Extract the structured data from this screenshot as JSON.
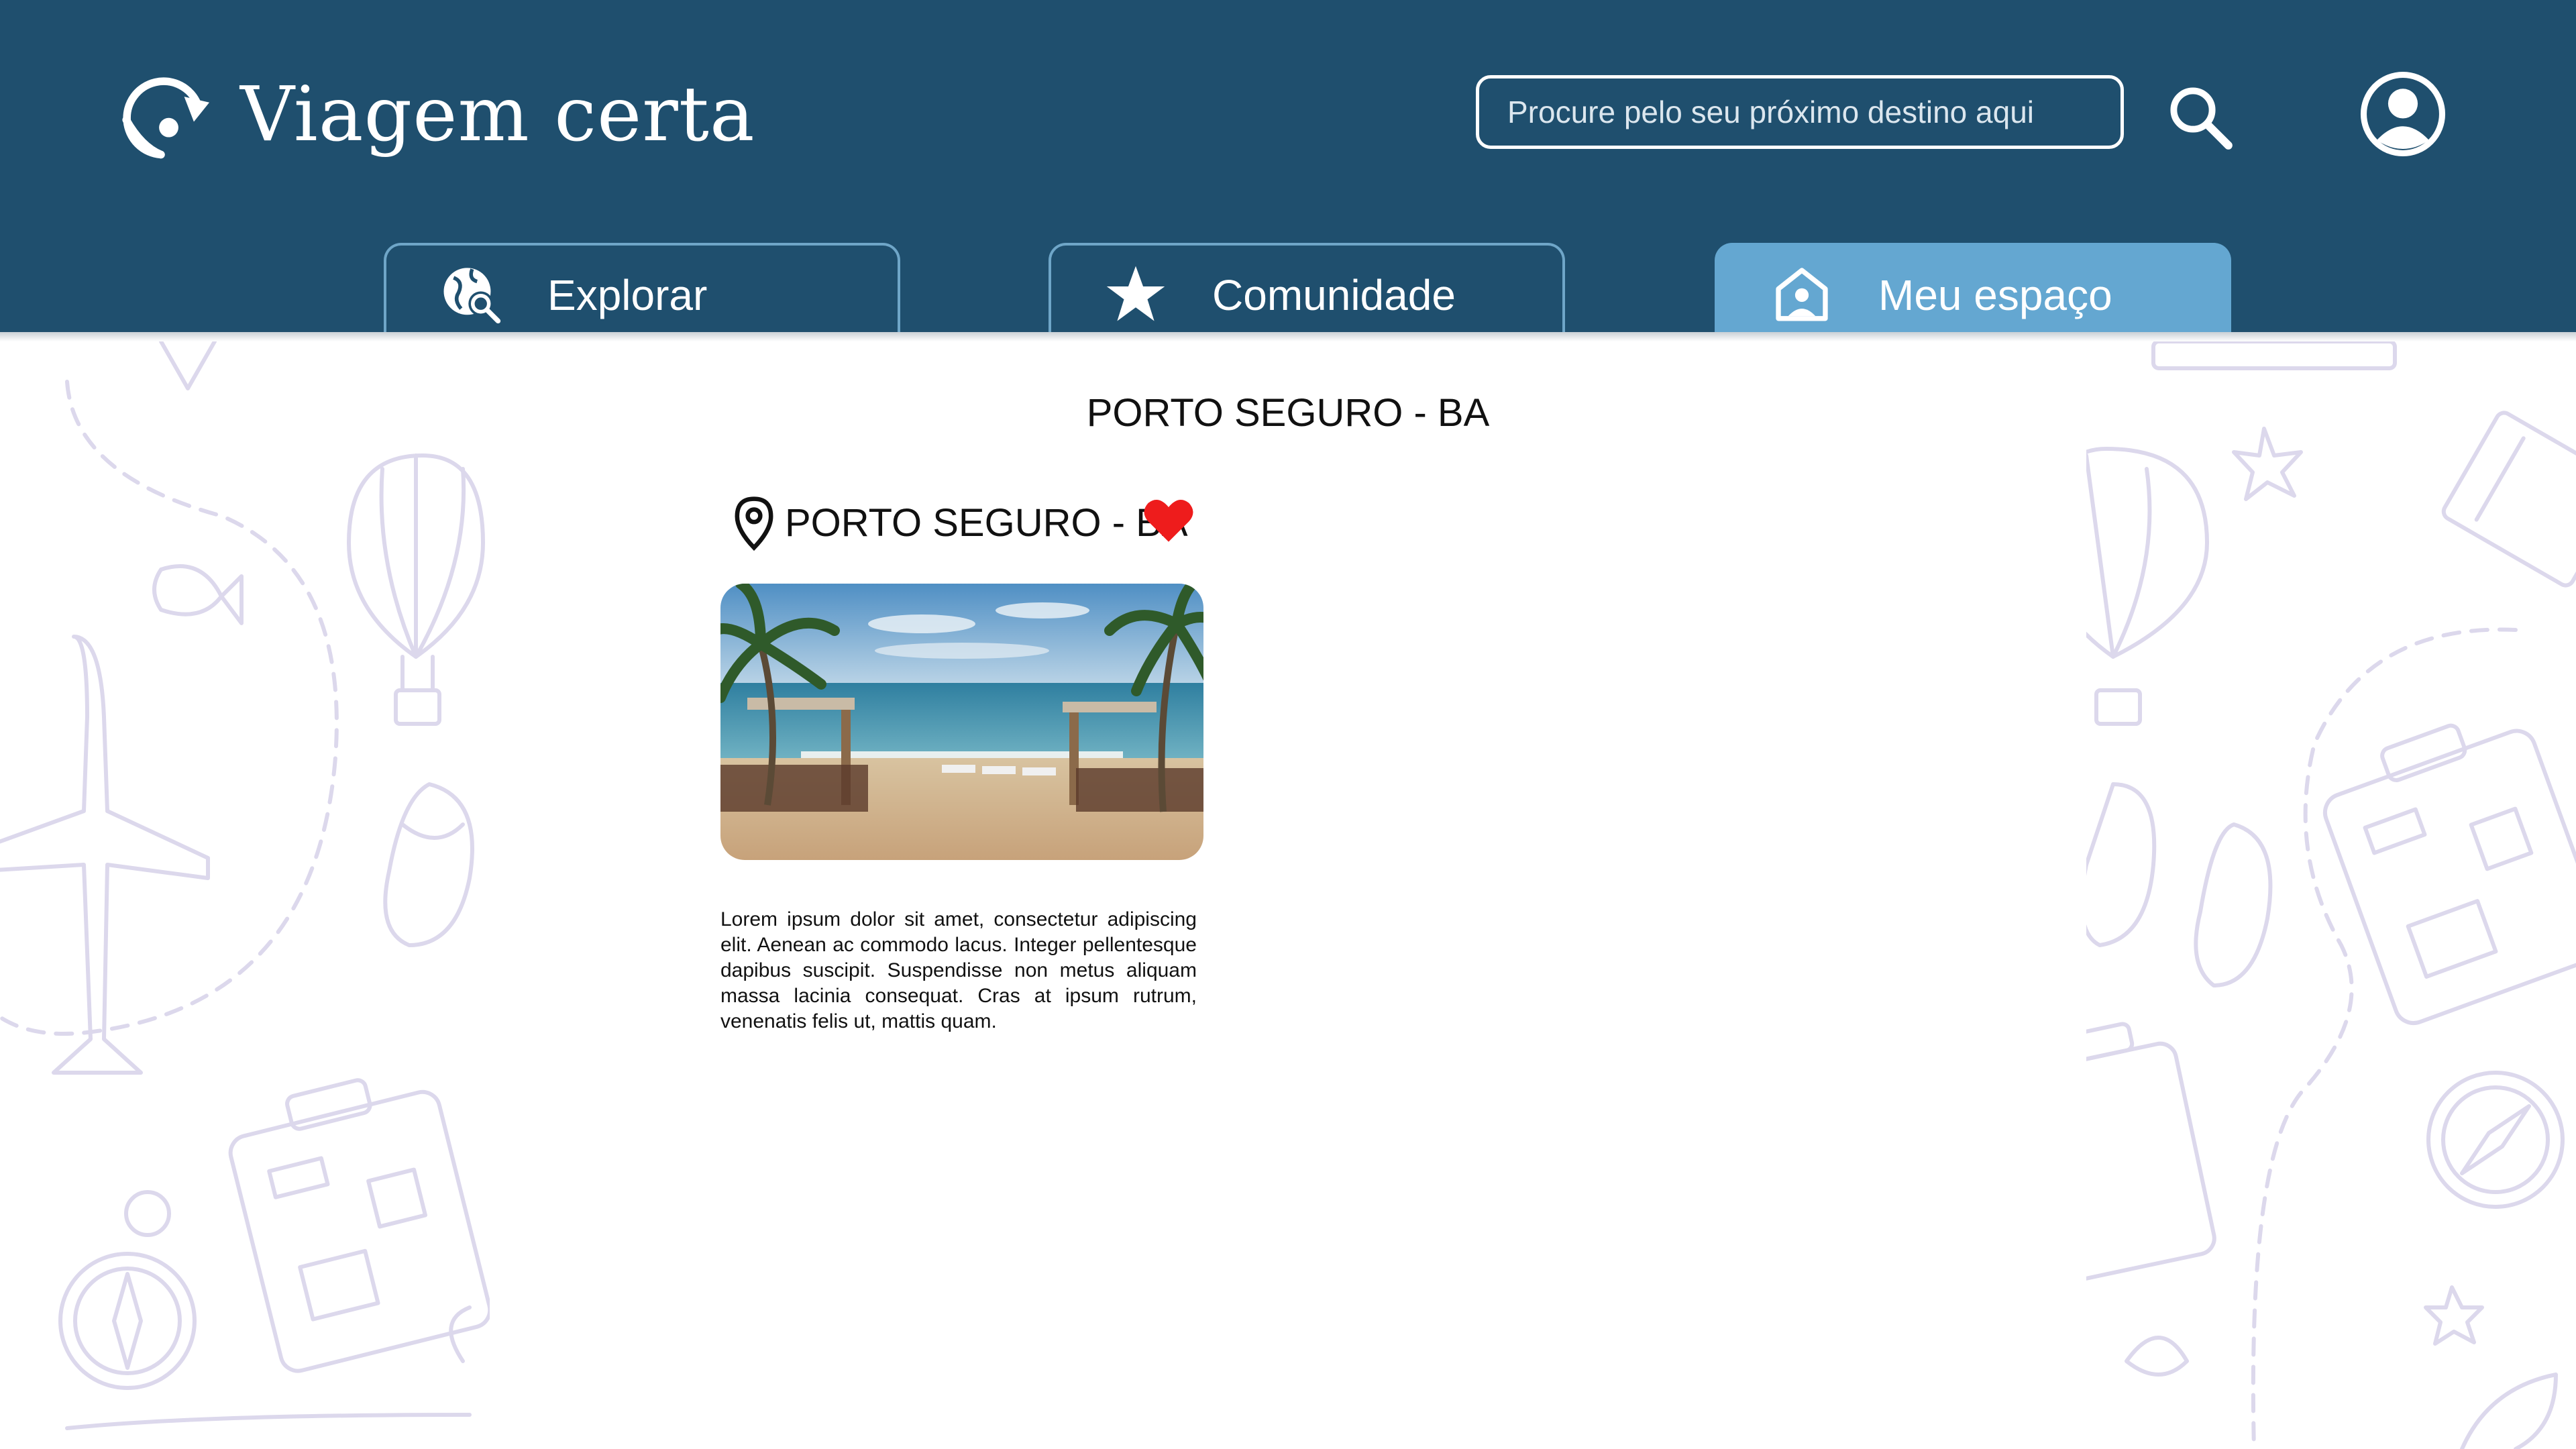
{
  "app": {
    "title": "Viagem certa"
  },
  "search": {
    "placeholder": "Procure pelo seu próximo destino aqui"
  },
  "icons": {
    "logo": "location-refresh-icon",
    "search": "search-icon",
    "profile": "user-circle-icon",
    "explorar": "globe-search-icon",
    "comunidade": "star-icon",
    "meu_espaco": "home-user-icon",
    "pin": "map-pin-icon",
    "favorite": "heart-icon"
  },
  "tabs": [
    {
      "label": "Explorar",
      "active": false
    },
    {
      "label": "Comunidade",
      "active": false
    },
    {
      "label": "Meu espaço",
      "active": true
    }
  ],
  "main": {
    "page_title": "PORTO SEGURO - BA",
    "card": {
      "title": "PORTO SEGURO - BA",
      "favorite": true,
      "description": "Lorem ipsum dolor sit amet, consectetur adipiscing elit. Aenean ac commodo lacus. Integer pellentesque dapibus suscipit. Suspendisse non metus aliquam massa lacinia consequat. Cras at ipsum rutrum, venenatis felis ut, mattis quam."
    }
  },
  "colors": {
    "header": "#1f4f6e",
    "tab_active": "#64a7d1",
    "tab_border": "#6fa6c8",
    "heart": "#ee1c1c",
    "doodle": "#dcd8ec"
  }
}
